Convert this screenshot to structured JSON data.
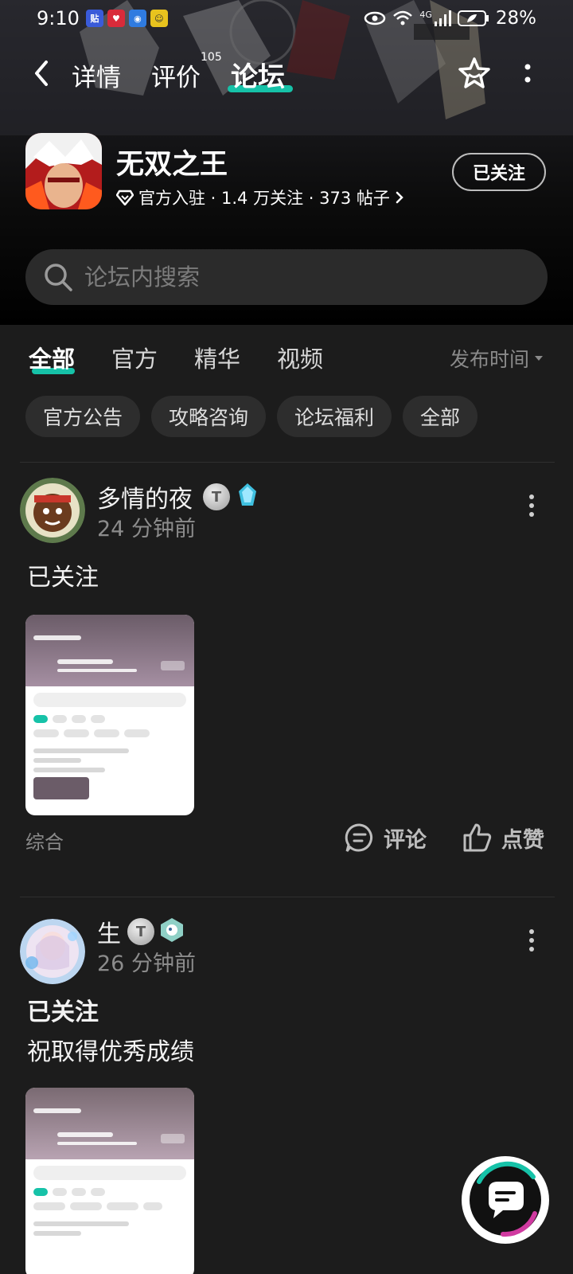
{
  "status_bar": {
    "time": "9:10",
    "network": "4G",
    "battery": "28%"
  },
  "nav": {
    "tabs": [
      {
        "label": "详情"
      },
      {
        "label": "评价",
        "count": "105"
      },
      {
        "label": "论坛"
      }
    ],
    "active_tab": "论坛",
    "accent_color": "#16c2a8"
  },
  "game": {
    "title": "无双之王",
    "meta": "官方入驻 · 1.4 万关注 · 373 帖子",
    "follow_label": "已关注"
  },
  "search": {
    "placeholder": "论坛内搜索"
  },
  "filters": {
    "tabs": [
      "全部",
      "官方",
      "精华",
      "视频"
    ],
    "active": "全部",
    "sort_label": "发布时间",
    "chips": [
      "官方公告",
      "攻略咨询",
      "论坛福利",
      "全部"
    ]
  },
  "posts": [
    {
      "username": "多情的夜",
      "time": "24 分钟前",
      "title": "已关注",
      "body": "",
      "category": "综合",
      "comment_label": "评论",
      "like_label": "点赞"
    },
    {
      "username": "生",
      "time": "26 分钟前",
      "title": "已关注",
      "body": "祝取得优秀成绩"
    }
  ]
}
